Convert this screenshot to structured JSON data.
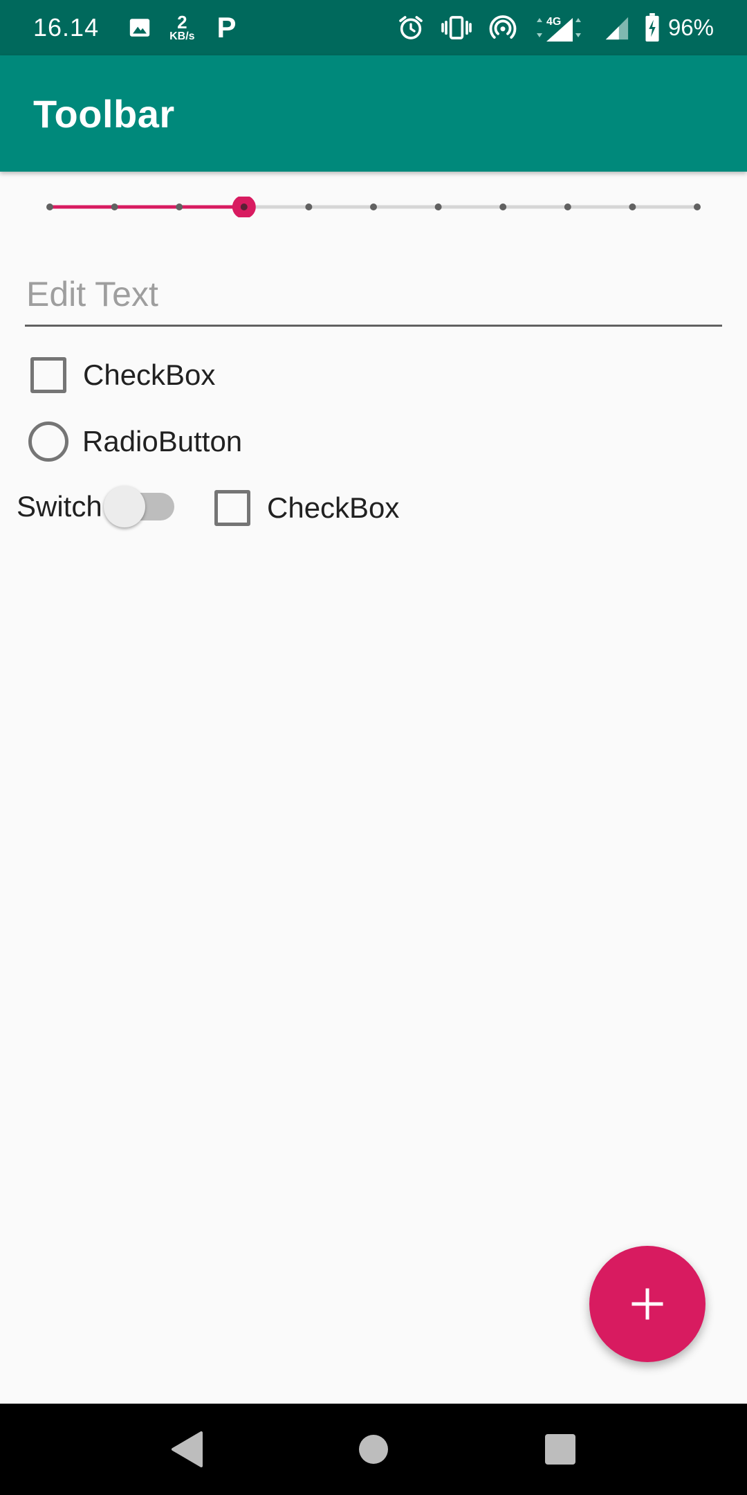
{
  "status_bar": {
    "time": "16.14",
    "data_speed_value": "2",
    "data_speed_unit": "KB/s",
    "app_badge": "P",
    "network_type": "4G",
    "battery_percent": "96%",
    "icons": [
      "image-icon",
      "alarm-icon",
      "vibrate-icon",
      "hotspot-icon",
      "signal-4g-icon",
      "signal-icon",
      "battery-charging-icon"
    ]
  },
  "toolbar": {
    "title": "Toolbar"
  },
  "seekbar": {
    "max": 10,
    "progress": 3,
    "accent_color": "#d81b60"
  },
  "edit_text": {
    "placeholder": "Edit Text",
    "value": ""
  },
  "checkbox_1": {
    "label": "CheckBox",
    "checked": false
  },
  "radio_button": {
    "label": "RadioButton",
    "checked": false
  },
  "switch": {
    "label": "Switch",
    "on": false
  },
  "checkbox_2": {
    "label": "CheckBox",
    "checked": false
  },
  "fab": {
    "icon": "plus-icon",
    "color": "#d81b60"
  },
  "colors": {
    "status_bar": "#00695c",
    "toolbar": "#00897b",
    "accent": "#d81b60",
    "background": "#fafafa"
  },
  "nav_bar": {
    "buttons": [
      "back-icon",
      "home-icon",
      "recents-icon"
    ]
  }
}
